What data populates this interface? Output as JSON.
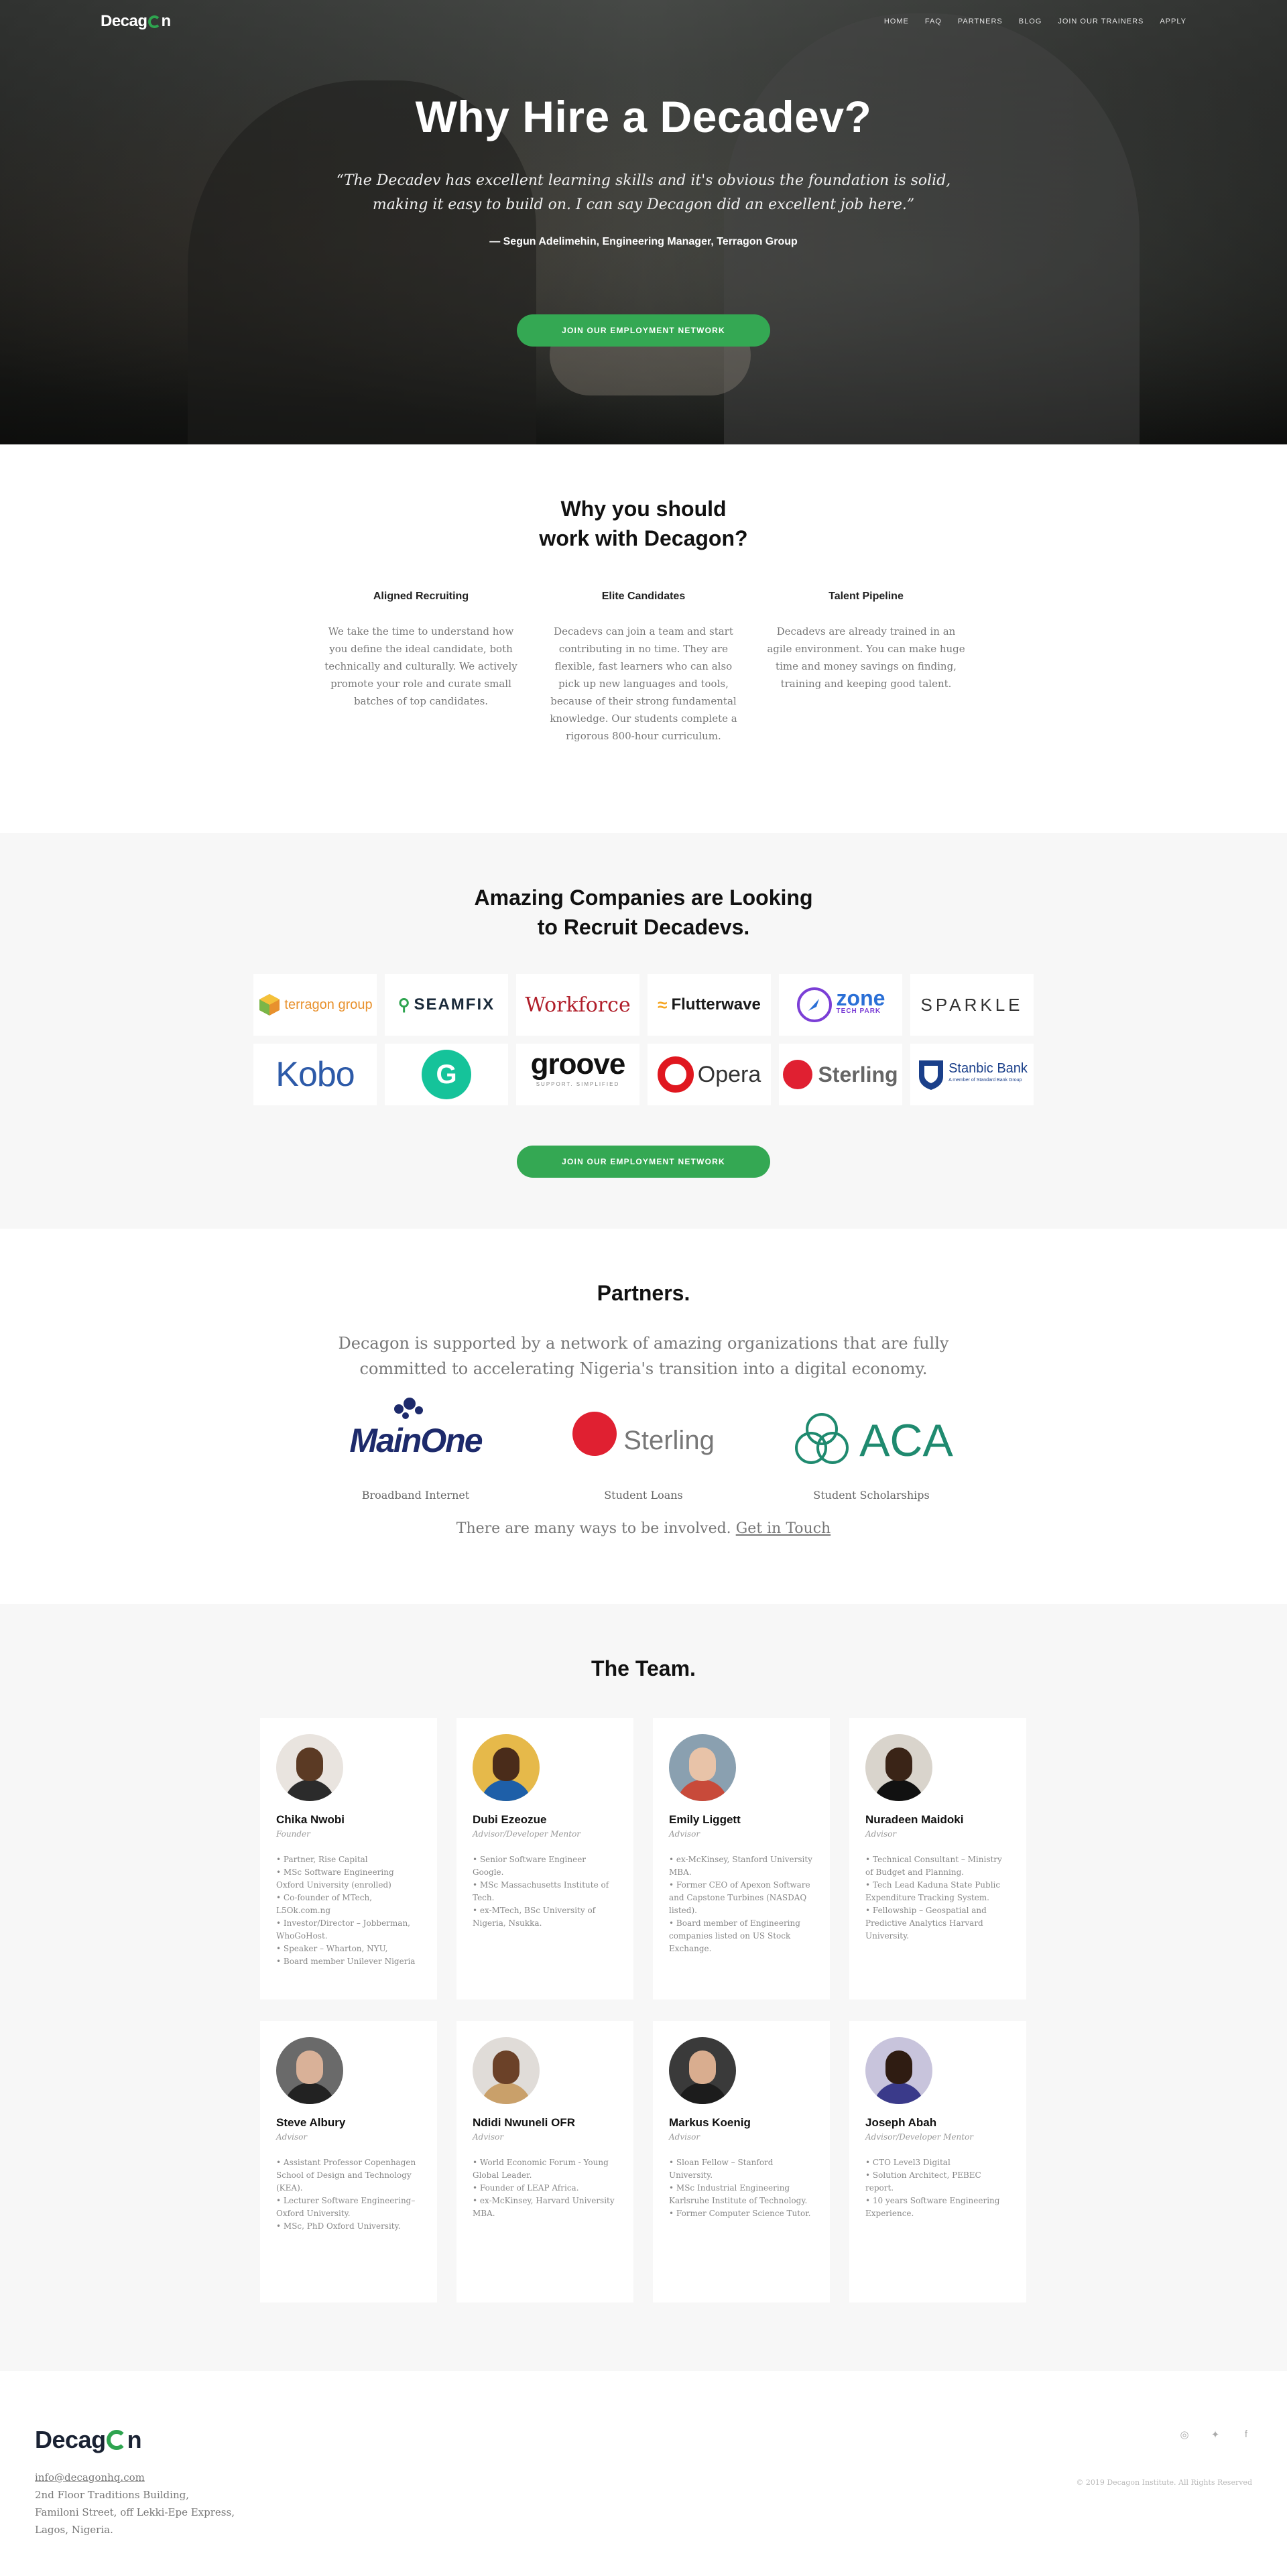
{
  "brand": {
    "name_pre": "Decag",
    "name_post": "n"
  },
  "nav": {
    "items": [
      "HOME",
      "FAQ",
      "PARTNERS",
      "BLOG",
      "JOIN OUR TRAINERS",
      "APPLY"
    ]
  },
  "hero": {
    "title": "Why Hire a Decadev?",
    "quote": "“The Decadev has excellent learning skills and it's obvious the foundation is solid, making it easy to build on. I can say Decagon did an excellent job here.”",
    "cite": "— Segun Adelimehin, Engineering Manager, Terragon Group",
    "cta": "JOIN OUR EMPLOYMENT NETWORK"
  },
  "why": {
    "title_line1": "Why you should",
    "title_line2": "work with Decagon?",
    "cols": [
      {
        "title": "Aligned Recruiting",
        "text": "We take the time to understand how you define the ideal candidate, both technically and culturally. We actively promote your role and curate small batches of top candidates."
      },
      {
        "title": "Elite Candidates",
        "text": "Decadevs can join a team and start contributing in no time. They are flexible, fast learners who can also pick up new languages and tools, because of their strong fundamental knowledge. Our students complete a rigorous 800-hour curriculum."
      },
      {
        "title": "Talent Pipeline",
        "text": "Decadevs are already trained in an agile environment. You can make huge time and money savings on finding, training and keeping good talent."
      }
    ]
  },
  "companies": {
    "title_line1": "Amazing Companies are Looking",
    "title_line2": "to Recruit Decadevs.",
    "logos": [
      {
        "name": "terragon group",
        "color": "#e8912d"
      },
      {
        "name": "SEAMFIX",
        "color": "#1a2a3a"
      },
      {
        "name": "Workforce",
        "color": "#b01e2a"
      },
      {
        "name": "Flutterwave",
        "color": "#1a1a1a"
      },
      {
        "name": "zone",
        "color": "#2a6fd6"
      },
      {
        "name": "SPARKLE",
        "color": "#333333"
      },
      {
        "name": "Kobo",
        "color": "#2d5aa8"
      },
      {
        "name": "G",
        "color": "#ffffff"
      },
      {
        "name": "groove",
        "color": "#111111"
      },
      {
        "name": "Opera",
        "color": "#333333"
      },
      {
        "name": "Sterling",
        "color": "#666666"
      },
      {
        "name": "Stanbic Bank",
        "color": "#1a3f8a"
      }
    ],
    "zone_sub": "TECH PARK",
    "groove_sub": "SUPPORT. SIMPLIFIED",
    "stanbic_sub": "A member of Standard Bank Group",
    "cta": "JOIN OUR EMPLOYMENT NETWORK"
  },
  "partners": {
    "title": "Partners.",
    "lead": "Decagon is supported by a network of amazing organizations that are fully committed to accelerating Nigeria's transition into a digital economy.",
    "items": [
      {
        "name": "MainOne",
        "caption": "Broadband Internet"
      },
      {
        "name": "Sterling",
        "caption": "Student Loans"
      },
      {
        "name": "ACA",
        "caption": "Student Scholarships"
      }
    ],
    "more_text": "There are many ways to be involved.",
    "more_link": "Get in Touch"
  },
  "team": {
    "title": "The Team.",
    "members": [
      {
        "name": "Chika Nwobi",
        "role": "Founder",
        "skin": "#5b3a24",
        "shirt": "#2b2b2b",
        "bg": "#e9e4df",
        "bullets": [
          "Partner, Rise Capital",
          "MSc Software Engineering Oxford University (enrolled)",
          "Co-founder of MTech, L5Ok.com.ng",
          "Investor/Director – Jobberman, WhoGoHost.",
          "Speaker – Wharton, NYU,",
          "Board member Unilever Nigeria"
        ]
      },
      {
        "name": "Dubi Ezeozue",
        "role": "Advisor/Developer Mentor",
        "skin": "#4a2c1a",
        "shirt": "#1e5fa8",
        "bg": "#e6b94a",
        "bullets": [
          "Senior Software Engineer Google.",
          "MSc Massachusetts Institute of Tech.",
          "ex-MTech, BSc University of Nigeria, Nsukka."
        ]
      },
      {
        "name": "Emily Liggett",
        "role": "Advisor",
        "skin": "#e8c3a8",
        "shirt": "#c84a3a",
        "bg": "#8aa0b0",
        "bullets": [
          "ex-McKinsey, Stanford University MBA.",
          "Former CEO of Apexon Software and Capstone Turbines (NASDAQ listed).",
          "Board member of Engineering companies listed on US Stock Exchange."
        ]
      },
      {
        "name": "Nuradeen Maidoki",
        "role": "Advisor",
        "skin": "#3a2417",
        "shirt": "#111111",
        "bg": "#d9d4cc",
        "bullets": [
          "Technical Consultant – Ministry of Budget and Planning.",
          "Tech Lead Kaduna State Public Expenditure Tracking System.",
          "Fellowship – Geospatial and Predictive Analytics Harvard University."
        ]
      },
      {
        "name": "Steve Albury",
        "role": "Advisor",
        "skin": "#d9b198",
        "shirt": "#222222",
        "bg": "#6a6a6a",
        "bullets": [
          "Assistant Professor Copenhagen School of Design and Technology (KEA).",
          "Lecturer Software Engineering– Oxford University.",
          "MSc, PhD Oxford University."
        ]
      },
      {
        "name": "Ndidi Nwuneli OFR",
        "role": "Advisor",
        "skin": "#6b4128",
        "shirt": "#c9a06a",
        "bg": "#e0dcd8",
        "bullets": [
          "World Economic Forum - Young Global Leader.",
          "Founder of LEAP Africa.",
          "ex-McKinsey, Harvard University MBA."
        ]
      },
      {
        "name": "Markus Koenig",
        "role": "Advisor",
        "skin": "#d9ad8f",
        "shirt": "#1c1c1c",
        "bg": "#3a3a3a",
        "bullets": [
          "Sloan Fellow – Stanford University.",
          "MSc Industrial Engineering Karlsruhe Institute of Technology.",
          "Former Computer Science Tutor."
        ]
      },
      {
        "name": "Joseph Abah",
        "role": "Advisor/Developer Mentor",
        "skin": "#2f1c12",
        "shirt": "#3a3a8a",
        "bg": "#c8c4dc",
        "bullets": [
          "CTO Level3 Digital",
          "Solution Architect, PEBEC report.",
          "10 years Software Engineering Experience."
        ]
      }
    ]
  },
  "footer": {
    "email": "info@decagonhq.com",
    "address": [
      "2nd Floor Traditions Building,",
      "Familoni Street, off Lekki-Epe Express,",
      "Lagos, Nigeria."
    ],
    "copyright": "© 2019 Decagon Institute. All Rights Reserved",
    "social": [
      "instagram-icon",
      "twitter-icon",
      "facebook-icon"
    ]
  }
}
